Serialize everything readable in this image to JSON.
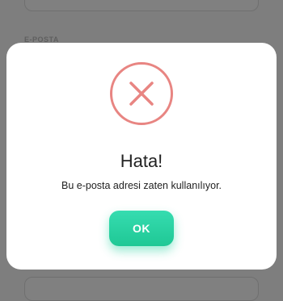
{
  "background_form": {
    "field_label": "E-POSTA"
  },
  "dialog": {
    "icon": "error-x-circle-icon",
    "title": "Hata!",
    "message": "Bu e-posta adresi zaten kullanılıyor.",
    "ok_label": "OK"
  },
  "colors": {
    "error": "#e88582",
    "ok_button": "#25d3a1",
    "overlay": "#7e7e7e"
  }
}
